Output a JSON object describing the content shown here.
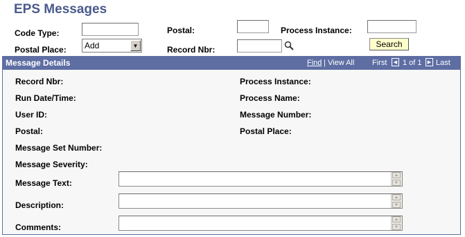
{
  "page": {
    "title": "EPS Messages"
  },
  "search": {
    "code_type_label": "Code Type:",
    "code_type_value": "",
    "postal_label": "Postal:",
    "postal_value": "",
    "process_instance_label": "Process Instance:",
    "process_instance_value": "",
    "postal_place_label": "Postal Place:",
    "postal_place_selected": "Add",
    "record_nbr_label": "Record Nbr:",
    "record_nbr_value": "",
    "search_button_label": "Search",
    "lookup_icon": "magnifier-icon"
  },
  "details": {
    "header_title": "Message Details",
    "find_link": "Find",
    "separator": "|",
    "view_all_label": "View All",
    "first_label": "First",
    "count_text": "1 of 1",
    "last_label": "Last",
    "left_labels": {
      "record_nbr": "Record Nbr:",
      "run_datetime": "Run Date/Time:",
      "user_id": "User ID:",
      "postal": "Postal:",
      "message_set_number": "Message Set Number:",
      "message_severity": "Message Severity:",
      "message_text": "Message Text:",
      "description": "Description:",
      "comments": "Comments:"
    },
    "right_labels": {
      "process_instance": "Process Instance:",
      "process_name": "Process Name:",
      "message_number": "Message Number:",
      "postal_place": "Postal Place:"
    },
    "message_text_value": "",
    "description_value": "",
    "comments_value": ""
  },
  "colors": {
    "title": "#4a5a8c",
    "panel_header": "#5e6ea3",
    "search_button": "#ffffcc"
  }
}
